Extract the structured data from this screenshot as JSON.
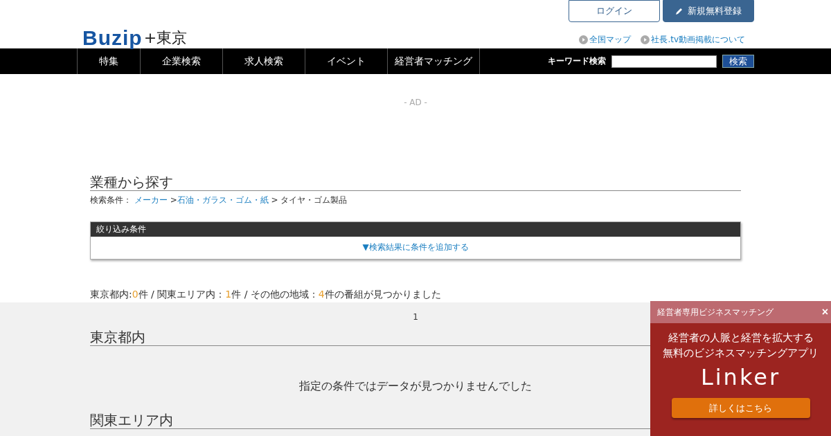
{
  "header": {
    "logo": {
      "brand": "Buzip",
      "suffix": "+東京"
    },
    "buttons": [
      {
        "label": "ログイン",
        "kind": "outline"
      },
      {
        "label": "新規無料登録",
        "kind": "primary"
      }
    ],
    "links": [
      "全国マップ",
      "社長.tv動画掲載について"
    ]
  },
  "nav": {
    "items": [
      "特集",
      "企業検索",
      "求人検索",
      "イベント",
      "経営者マッチング"
    ],
    "search": {
      "label": "キーワード検索",
      "button": "検索"
    }
  },
  "ad": "- AD -",
  "section": {
    "title": "業種から探す",
    "breadcrumb": {
      "label": "検索条件：",
      "links": [
        "メーカー",
        "石油・ガラス・ゴム・紙"
      ],
      "separator": ">",
      "current": "タイヤ・ゴム製品"
    }
  },
  "filter": {
    "title": "絞り込み条件",
    "toggle": "▼検索結果に条件を追加する"
  },
  "summary": [
    {
      "label": "東京都内:",
      "count": "0",
      "unit": "件"
    },
    {
      "label": " / 関東エリア内：",
      "count": "1",
      "unit": "件"
    },
    {
      "label": " / その他の地域：",
      "count": "4",
      "unit": "件の番組が見つかりました"
    }
  ],
  "pagination": [
    "1"
  ],
  "results": [
    {
      "title": "東京都内",
      "message": "指定の条件ではデータが見つかりませんでした"
    },
    {
      "title": "関東エリア内"
    }
  ],
  "popup": {
    "title": "経営者専用ビジネスマッチング",
    "close": "×",
    "lines": [
      "経営者の人脈と経営を拡大する",
      "無料のビジネスマッチングアプリ"
    ],
    "logo": "Linker",
    "button": "詳しくはこちら"
  }
}
